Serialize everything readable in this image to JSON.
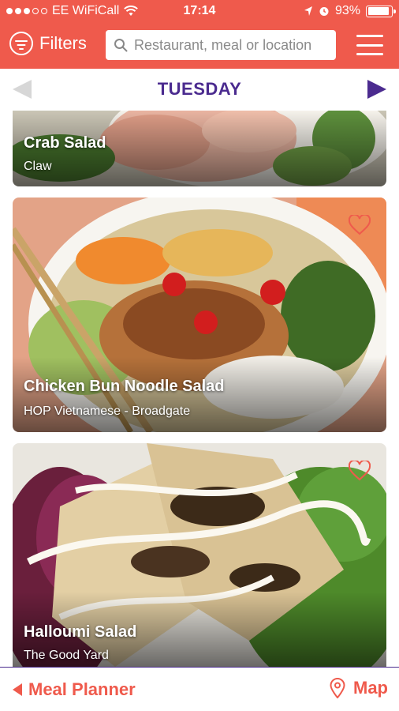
{
  "status_bar": {
    "carrier": "EE WiFiCall",
    "time": "17:14",
    "battery_text": "93%",
    "battery_level": 0.93,
    "signal_bars_filled": 3,
    "signal_bars_total": 5
  },
  "header": {
    "filters_label": "Filters",
    "search_placeholder": "Restaurant, meal or location"
  },
  "day_nav": {
    "day": "TUESDAY"
  },
  "meals": [
    {
      "name": "Crab Salad",
      "restaurant": "Claw"
    },
    {
      "name": "Chicken Bun Noodle Salad",
      "restaurant": "HOP Vietnamese - Broadgate"
    },
    {
      "name": "Halloumi Salad",
      "restaurant": "The Good Yard"
    }
  ],
  "bottom_nav": {
    "planner_label": "Meal Planner",
    "map_label": "Map"
  },
  "colors": {
    "brand_red": "#ef5a4c",
    "accent_purple": "#4b2b8f",
    "inactive_arrow": "#d7d7d7"
  },
  "icons": [
    "filter-icon",
    "search-icon",
    "hamburger-menu-icon",
    "heart-icon",
    "map-pin-icon",
    "wifi-icon",
    "location-arrow-icon",
    "alarm-icon",
    "battery-icon"
  ]
}
